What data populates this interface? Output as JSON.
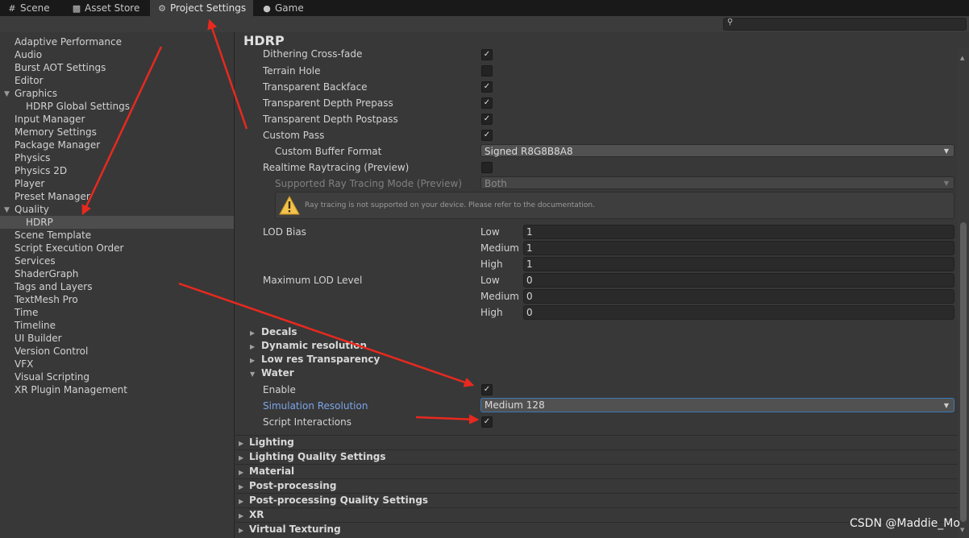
{
  "tabs": [
    {
      "label": "Scene",
      "icon": "grid-icon"
    },
    {
      "label": "Asset Store",
      "icon": "shopping-bag-icon"
    },
    {
      "label": "Project Settings",
      "icon": "gear-icon"
    },
    {
      "label": "Game",
      "icon": "gamepad-icon"
    }
  ],
  "sidebar": {
    "items": [
      {
        "label": "Adaptive Performance"
      },
      {
        "label": "Audio"
      },
      {
        "label": "Burst AOT Settings"
      },
      {
        "label": "Editor"
      },
      {
        "label": "Graphics"
      },
      {
        "label": "HDRP Global Settings"
      },
      {
        "label": "Input Manager"
      },
      {
        "label": "Memory Settings"
      },
      {
        "label": "Package Manager"
      },
      {
        "label": "Physics"
      },
      {
        "label": "Physics 2D"
      },
      {
        "label": "Player"
      },
      {
        "label": "Preset Manager"
      },
      {
        "label": "Quality"
      },
      {
        "label": "HDRP"
      },
      {
        "label": "Scene Template"
      },
      {
        "label": "Script Execution Order"
      },
      {
        "label": "Services"
      },
      {
        "label": "ShaderGraph"
      },
      {
        "label": "Tags and Layers"
      },
      {
        "label": "TextMesh Pro"
      },
      {
        "label": "Time"
      },
      {
        "label": "Timeline"
      },
      {
        "label": "UI Builder"
      },
      {
        "label": "Version Control"
      },
      {
        "label": "VFX"
      },
      {
        "label": "Visual Scripting"
      },
      {
        "label": "XR Plugin Management"
      }
    ]
  },
  "header": {
    "title": "HDRP"
  },
  "props": {
    "dithering": "Dithering Cross-fade",
    "terrain_hole": "Terrain Hole",
    "transparent_backface": "Transparent Backface",
    "transparent_depth_prepass": "Transparent Depth Prepass",
    "transparent_depth_postpass": "Transparent Depth Postpass",
    "custom_pass": "Custom Pass",
    "custom_buffer_format": "Custom Buffer Format",
    "custom_buffer_format_value": "Signed R8G8B8A8",
    "realtime_raytracing": "Realtime Raytracing (Preview)",
    "ray_tracing_mode": "Supported Ray Tracing Mode (Preview)",
    "ray_tracing_mode_value": "Both",
    "ray_warning": "Ray tracing is not supported on your device. Please refer to the documentation.",
    "lod_bias": "LOD Bias",
    "max_lod_level": "Maximum LOD Level",
    "low": "Low",
    "medium": "Medium",
    "high": "High",
    "lod_bias_low": "1",
    "lod_bias_medium": "1",
    "lod_bias_high": "1",
    "max_lod_low": "0",
    "max_lod_medium": "0",
    "max_lod_high": "0"
  },
  "subsections": {
    "decals": "Decals",
    "dynamic_resolution": "Dynamic resolution",
    "low_res_transparency": "Low res Transparency",
    "water": "Water"
  },
  "water": {
    "enable": "Enable",
    "simulation_resolution": "Simulation Resolution",
    "simulation_resolution_value": "Medium 128",
    "script_interactions": "Script Interactions"
  },
  "sections": [
    "Lighting",
    "Lighting Quality Settings",
    "Material",
    "Post-processing",
    "Post-processing Quality Settings",
    "XR",
    "Virtual Texturing"
  ],
  "watermark": "CSDN @Maddie_Mo",
  "colors": {
    "annotation_arrow": "#e8291f",
    "accent_blue": "#7ba4e8",
    "selection": "#4d4d4d"
  },
  "checkbox_states": {
    "dithering": true,
    "terrain_hole": false,
    "transparent_backface": true,
    "transparent_depth_prepass": true,
    "transparent_depth_postpass": true,
    "custom_pass": true,
    "realtime_raytracing": false,
    "water_enable": true,
    "script_interactions": true
  }
}
